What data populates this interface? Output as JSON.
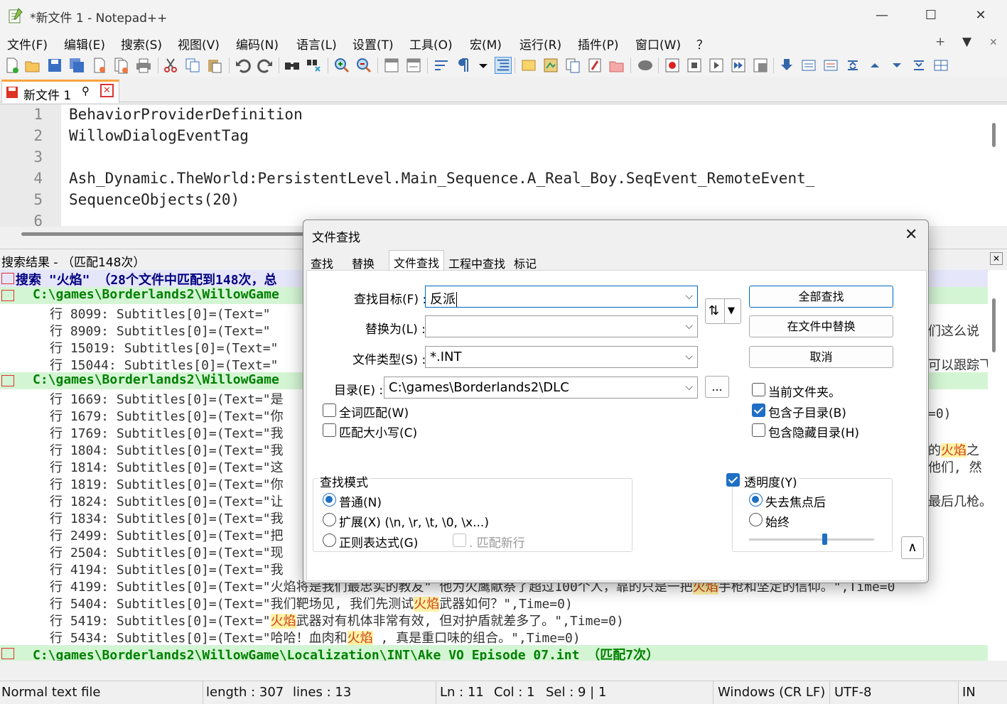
{
  "window": {
    "title": "*新文件 1 - Notepad++",
    "min": "—",
    "max": "☐",
    "close": "✕"
  },
  "menu": [
    "文件(F)",
    "编辑(E)",
    "搜索(S)",
    "视图(V)",
    "编码(N)",
    "语言(L)",
    "设置(T)",
    "工具(O)",
    "宏(M)",
    "运行(R)",
    "插件(P)",
    "窗口(W)",
    "？"
  ],
  "menu_right": {
    "plus": "+",
    "down": "▼",
    "close": "✕"
  },
  "tab": {
    "label": "新文件 1",
    "pin": "📌",
    "close": "✕"
  },
  "editor": {
    "line_numbers": [
      "1",
      "2",
      "3",
      "4",
      "5",
      "6"
    ],
    "lines": [
      "BehaviorProviderDefinition",
      "WillowDialogEventTag",
      "",
      "Ash_Dynamic.TheWorld:PersistentLevel.Main_Sequence.A_Real_Boy.SeqEvent_RemoteEvent_",
      "SequenceObjects(20)",
      ""
    ]
  },
  "results_header": {
    "title": "搜索结果 - （匹配148次）",
    "close": "✕"
  },
  "results": {
    "search_line": "搜索 \"火焰\" （28个文件中匹配到148次，总",
    "file1": "C:\\games\\Borderlands2\\WillowGame",
    "group1": [
      {
        "pre": "行  8099: Subtitles[0]=(Text=\"",
        "tail": ""
      },
      {
        "pre": "行  8909: Subtitles[0]=(Text=\"",
        "tail": "们这么说"
      },
      {
        "pre": "行 15019: Subtitles[0]=(Text=\"",
        "tail": ""
      },
      {
        "pre": "行 15044: Subtitles[0]=(Text=\"",
        "tail": "可以跟踪飞"
      }
    ],
    "file2": "C:\\games\\Borderlands2\\WillowGame",
    "group2": [
      {
        "pre": "行 1669: Subtitles[0]=(Text=\"是",
        "tail": ""
      },
      {
        "pre": "行 1679: Subtitles[0]=(Text=\"你",
        "tail": "=0)"
      },
      {
        "pre": "行 1769: Subtitles[0]=(Text=\"我",
        "tail": ""
      },
      {
        "pre": "行 1804: Subtitles[0]=(Text=\"我",
        "tail_pre": "的",
        "tail_hl": "火焰",
        "tail_post": "之"
      },
      {
        "pre": "行 1814: Subtitles[0]=(Text=\"这",
        "tail": "他们, 然"
      },
      {
        "pre": "行 1819: Subtitles[0]=(Text=\"你",
        "tail": ""
      },
      {
        "pre": "行 1824: Subtitles[0]=(Text=\"让",
        "tail": "最后几枪。"
      },
      {
        "pre": "行 1834: Subtitles[0]=(Text=\"我",
        "tail": ""
      },
      {
        "pre": "行 2499: Subtitles[0]=(Text=\"把",
        "tail": ""
      },
      {
        "pre": "行 2504: Subtitles[0]=(Text=\"现",
        "tail": ""
      },
      {
        "pre": "行 4194: Subtitles[0]=(Text=\"我",
        "tail": ""
      }
    ],
    "line4199": {
      "pre": "行 4199: Subtitles[0]=(Text=\"火焰将是我们最忠实的教友\" 他为火鹰献祭了超过100个人，靠的只是一把",
      "hl": "火焰",
      "post": "手枪和坚定的信仰。\",Time=0"
    },
    "line5404": {
      "pre": "行 5404: Subtitles[0]=(Text=\"我们靶场见, 我们先测试",
      "hl": "火焰",
      "post": "武器如何？\",Time=0)"
    },
    "line5419": {
      "pre": "行 5419: Subtitles[0]=(Text=\"",
      "hl": "火焰",
      "post": "武器对有机体非常有效, 但对护盾就差多了。\",Time=0)"
    },
    "line5434": {
      "pre": "行 5434: Subtitles[0]=(Text=\"哈哈！血肉和",
      "hl": "火焰",
      "post": " , 真是重口味的组合。\",Time=0)"
    },
    "file3": "C:\\games\\Borderlands2\\WillowGame\\Localization\\INT\\Ake_VO_Episode_07.int （匹配7次）",
    "hl_word": "火焰"
  },
  "status": {
    "type": "Normal text file",
    "length": "length : 307",
    "lines": "lines : 13",
    "ln": "Ln : 11",
    "col": "Col : 1",
    "sel": "Sel : 9 | 1",
    "eol": "Windows (CR LF)",
    "enc": "UTF-8",
    "ins": "IN"
  },
  "dialog": {
    "title": "文件查找",
    "close": "✕",
    "tabs": [
      "查找",
      "替换",
      "文件查找",
      "工程中查找",
      "标记"
    ],
    "find_label": "查找目标(F) :",
    "find_value": "反派",
    "replace_label": "替换为(L) :",
    "replace_value": "",
    "filter_label": "文件类型(S) :",
    "filter_value": "*.INT",
    "dir_label": "目录(E) :",
    "dir_value": "C:\\games\\Borderlands2\\DLC",
    "browse": "...",
    "swap": "⇅",
    "btn_find_all": "全部查找",
    "btn_replace_files": "在文件中替换",
    "btn_cancel": "取消",
    "cb_current_folder": "当前文件夹。",
    "cb_subfolders": "包含子目录(B)",
    "cb_hidden": "包含隐藏目录(H)",
    "cb_whole_word": "全词匹配(W)",
    "cb_match_case": "匹配大小写(C)",
    "mode_title": "查找模式",
    "mode_normal": "普通(N)",
    "mode_extended": "扩展(X) (\\n, \\r, \\t, \\0, \\x...)",
    "mode_regex": "正则表达式(G)",
    "dot_newline": ". 匹配新行",
    "transparency": "透明度(Y)",
    "trans_on_lose": "失去焦点后",
    "trans_always": "始终",
    "transparency_level": 0.6,
    "collapse": "∧"
  }
}
